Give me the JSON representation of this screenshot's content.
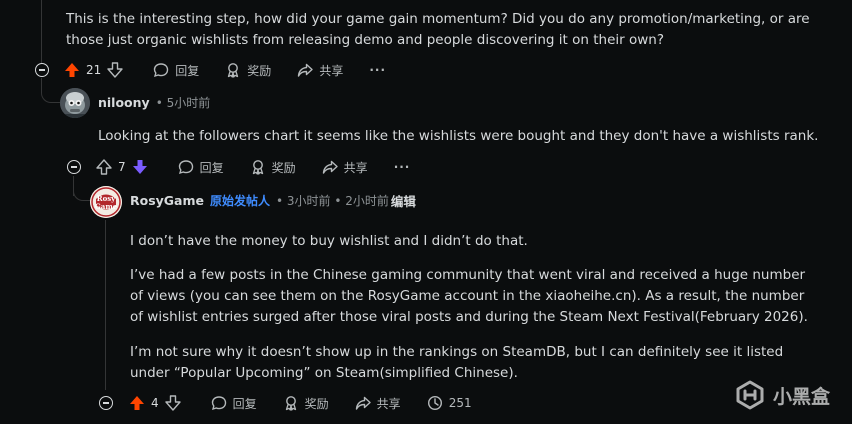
{
  "comment_top": {
    "lines": [
      "This is the interesting step, how did your game gain momentum? Did you do any promotion/marketing, or are",
      "those just organic wishlists from releasing demo and people discovering it on their own?"
    ],
    "score": "21",
    "actions": {
      "reply": "回复",
      "award": "奖励",
      "share": "共享",
      "more": "···"
    }
  },
  "comment_niloony": {
    "username": "niloony",
    "time": "• 5小时前",
    "body": "Looking at the followers chart it seems like the wishlists were bought and they don't have a wishlists rank.",
    "score": "7",
    "actions": {
      "reply": "回复",
      "award": "奖励",
      "share": "共享",
      "more": "···"
    }
  },
  "comment_rosygame": {
    "username": "RosyGame",
    "op_tag": "原始发帖人",
    "time": "• 3小时前 • 2小时前",
    "edited": "编辑",
    "avatar_text": "Rosy Game",
    "paragraphs": [
      [
        "I don’t have the money to buy wishlist and I didn’t do that."
      ],
      [
        "I’ve had a few posts in the Chinese gaming community that went viral and received a huge number",
        "of views (you can see them on the RosyGame account in the xiaoheihe.cn). As a result, the number",
        "of wishlist entries surged after those viral posts and during the Steam Next Festival(February 2026)."
      ],
      [
        "I’m not sure why it doesn’t show up in the rankings on SteamDB, but I can definitely see it listed",
        "under “Popular Upcoming” on Steam(simplified Chinese)."
      ]
    ],
    "score": "4",
    "views": "251",
    "actions": {
      "reply": "回复",
      "award": "奖励",
      "share": "共享"
    }
  },
  "watermark": {
    "text": "小黑盒"
  },
  "colors": {
    "upvote_active": "#ff4500",
    "downvote_active": "#7a5cff",
    "op_tag": "#3f8cff",
    "background": "#0b0d0e"
  }
}
